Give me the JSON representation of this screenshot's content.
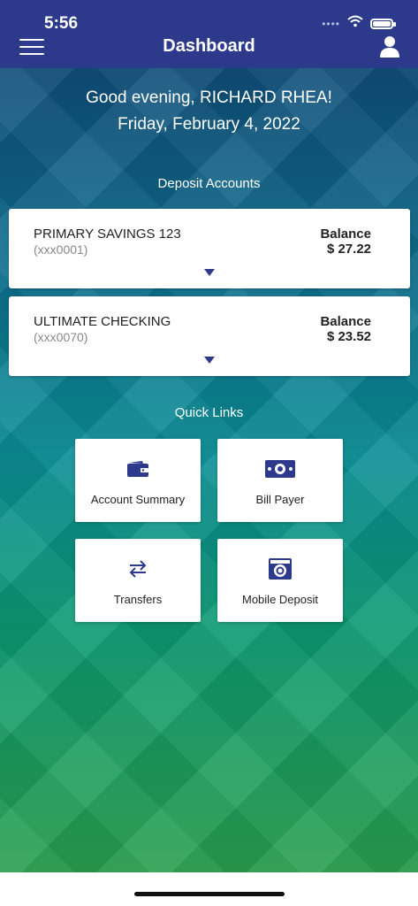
{
  "status_bar": {
    "time": "5:56",
    "signal": "••••",
    "battery_level": 0.9
  },
  "header": {
    "title": "Dashboard"
  },
  "greeting": {
    "line1": "Good evening, RICHARD RHEA!",
    "line2": "Friday, February 4, 2022"
  },
  "deposit_accounts": {
    "title": "Deposit Accounts",
    "items": [
      {
        "name": "PRIMARY SAVINGS 123",
        "mask": "(xxx0001)",
        "balance_label": "Balance",
        "balance": "$ 27.22"
      },
      {
        "name": "ULTIMATE CHECKING",
        "mask": "(xxx0070)",
        "balance_label": "Balance",
        "balance": "$ 23.52"
      }
    ]
  },
  "quick_links": {
    "title": "Quick Links",
    "items": [
      {
        "label": "Account Summary",
        "icon": "wallet-icon"
      },
      {
        "label": "Bill Payer",
        "icon": "money-bill-icon"
      },
      {
        "label": "Transfers",
        "icon": "transfer-arrows-icon"
      },
      {
        "label": "Mobile Deposit",
        "icon": "camera-icon"
      }
    ]
  },
  "colors": {
    "brand": "#2d3a8c",
    "card": "#ffffff"
  }
}
